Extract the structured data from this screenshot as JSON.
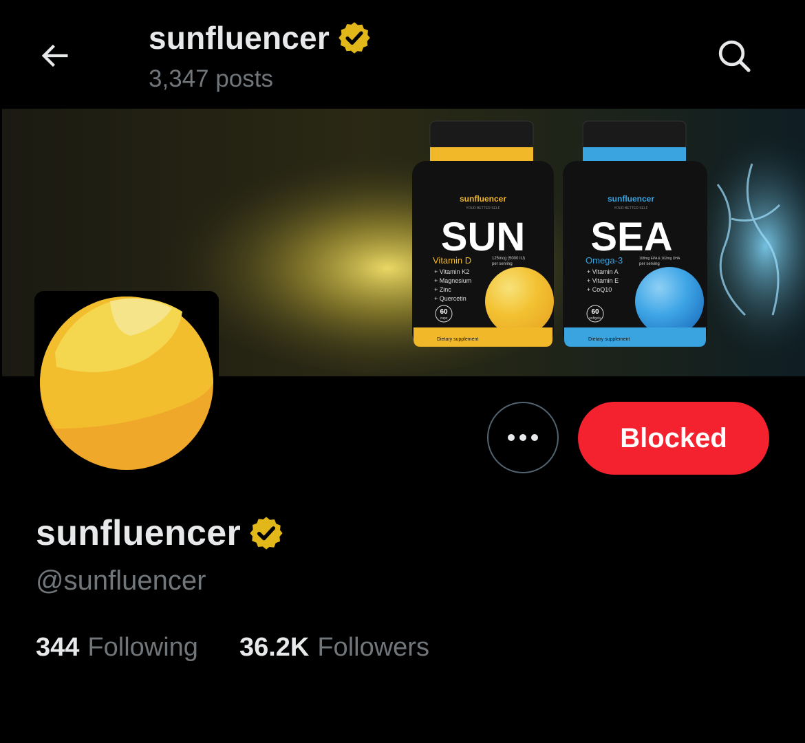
{
  "header": {
    "title": "sunfluencer",
    "posts_count": "3,347 posts"
  },
  "banner": {
    "bottle_sun": {
      "brand": "sunfluencer",
      "tagline": "YOUR BETTER SELF",
      "name": "SUN",
      "subtitle": "Vitamin D",
      "dose": "125mcg (5000 IU)",
      "dose2": "per serving",
      "ingredients": [
        "+ Vitamin K2",
        "+ Magnesium",
        "+ Zinc",
        "+ Quercetin"
      ],
      "count": "60",
      "count_unit": "caps",
      "footer": "Dietary supplement"
    },
    "bottle_sea": {
      "brand": "sunfluencer",
      "tagline": "YOUR BETTER SELF",
      "name": "SEA",
      "subtitle": "Omega-3",
      "dose": "108mg EPA & 162mg DHA",
      "dose2": "per serving",
      "ingredients": [
        "+ Vitamin A",
        "+ Vitamin E",
        "+ CoQ10"
      ],
      "count": "60",
      "count_unit": "softgels",
      "footer": "Dietary supplement"
    }
  },
  "profile": {
    "display_name": "sunfluencer",
    "handle": "@sunfluencer",
    "following_count": "344",
    "following_label": "Following",
    "followers_count": "36.2K",
    "followers_label": "Followers"
  },
  "actions": {
    "more_icon": "more-horizontal-icon",
    "blocked_label": "Blocked"
  },
  "icons": {
    "back": "arrow-left-icon",
    "search": "search-icon",
    "verified": "verified-badge-icon"
  },
  "colors": {
    "background": "#000000",
    "blocked_button": "#f4212e",
    "verified_gold": "#e2b719",
    "secondary_text": "#71767b",
    "sun_yellow": "#f5b82e",
    "sea_blue": "#2f9bd9"
  }
}
